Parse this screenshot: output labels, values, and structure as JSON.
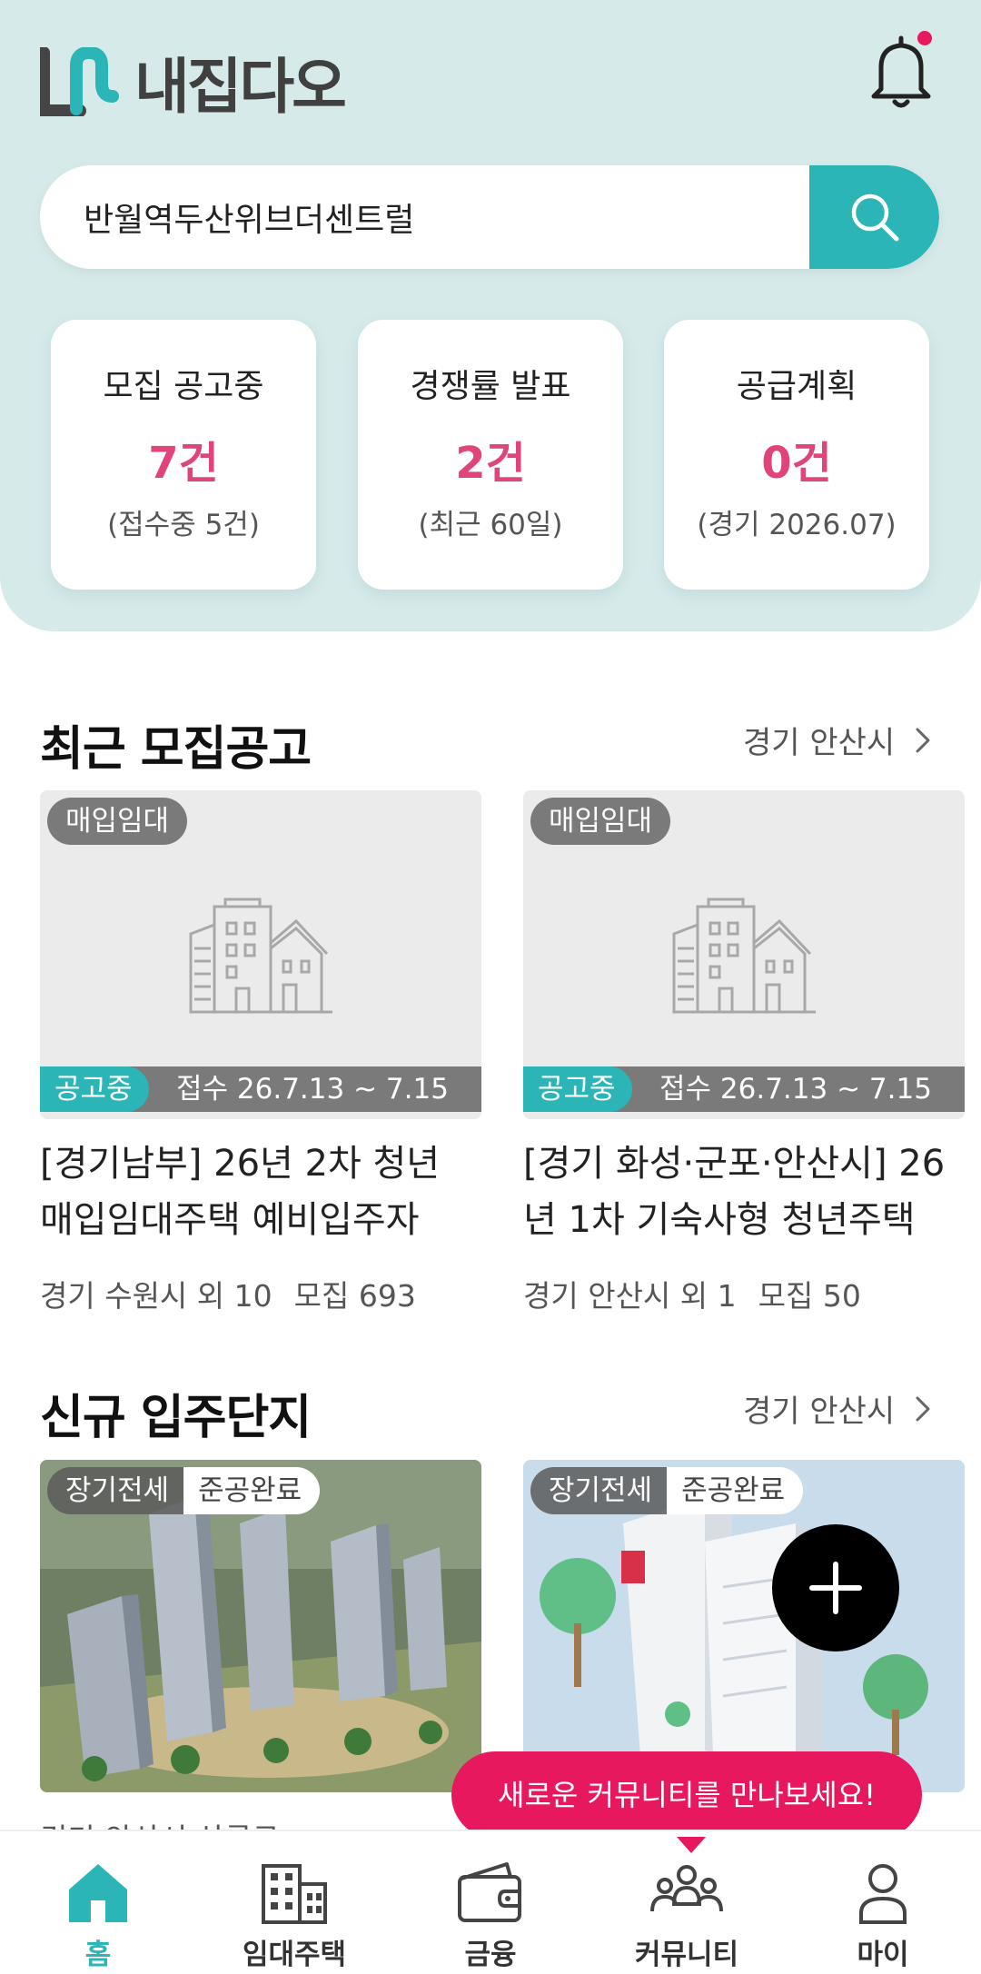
{
  "app": {
    "name": "내집다오",
    "accent_color": "#2bb5b6",
    "highlight_color": "#e0447a",
    "notification_dot_color": "#e8195e"
  },
  "search": {
    "value": "반월역두산위브더센트럴",
    "icon": "search-icon"
  },
  "stats": [
    {
      "label": "모집 공고중",
      "value": "7건",
      "sub": "(접수중 5건)"
    },
    {
      "label": "경쟁률 발표",
      "value": "2건",
      "sub": "(최근 60일)"
    },
    {
      "label": "공급계획",
      "value": "0건",
      "sub": "(경기 2026.07)"
    }
  ],
  "recent": {
    "title": "최근 모집공고",
    "region_link": "경기 안산시",
    "cards": [
      {
        "tag": "매입임대",
        "status": "공고중",
        "date": "접수 26.7.13 ~ 7.15",
        "title_line1": "[경기남부] 26년 2차 청년",
        "title_line2": "매입임대주택 예비입주자",
        "region": "경기 수원시 외 10",
        "count": "모집 693"
      },
      {
        "tag": "매입임대",
        "status": "공고중",
        "date": "접수 26.7.13 ~ 7.15",
        "title_line1": "[경기 화성·군포·안산시] 26",
        "title_line2": "년 1차 기숙사형 청년주택",
        "region": "경기 안산시 외 1",
        "count": "모집 50"
      }
    ]
  },
  "complexes": {
    "title": "신규 입주단지",
    "region_link": "경기 안산시",
    "cards": [
      {
        "tag1": "장기전세",
        "tag2": "준공완료"
      },
      {
        "tag1": "장기전세",
        "tag2": "준공완료"
      }
    ],
    "peek_text": "경기 안산시 상록구"
  },
  "toast": "새로운 커뮤니티를 만나보세요!",
  "nav": [
    {
      "label": "홈",
      "icon": "home-icon",
      "active": true
    },
    {
      "label": "임대주택",
      "icon": "building-icon",
      "active": false
    },
    {
      "label": "금융",
      "icon": "wallet-icon",
      "active": false
    },
    {
      "label": "커뮤니티",
      "icon": "community-icon",
      "active": false
    },
    {
      "label": "마이",
      "icon": "user-icon",
      "active": false
    }
  ]
}
